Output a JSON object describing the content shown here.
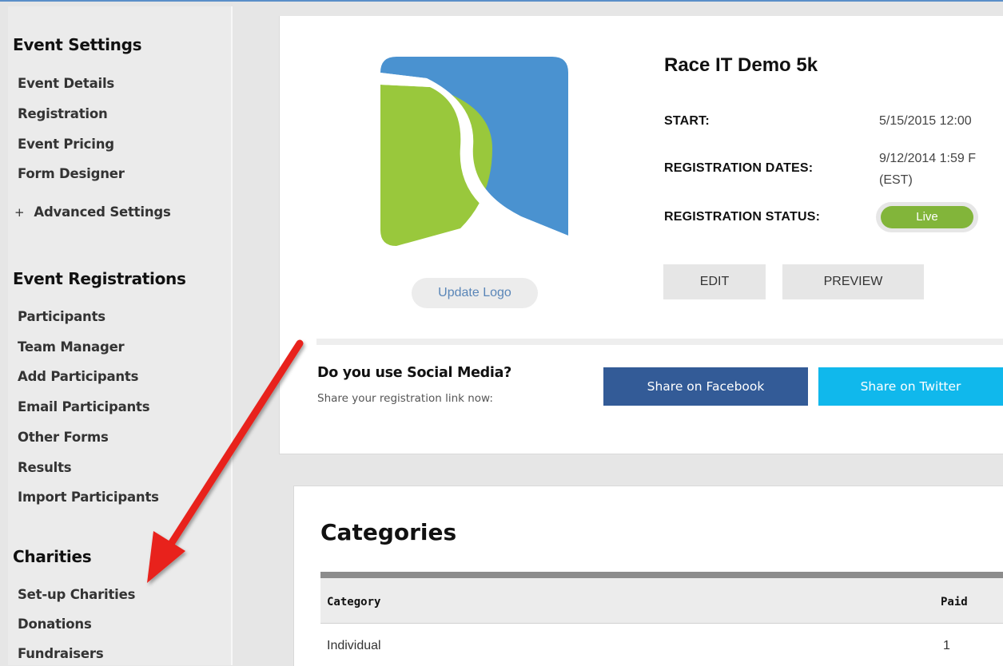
{
  "sidebar": {
    "sections": [
      {
        "title": "Event Settings",
        "items": [
          "Event Details",
          "Registration",
          "Event Pricing",
          "Form Designer"
        ],
        "advanced": "Advanced Settings"
      },
      {
        "title": "Event Registrations",
        "items": [
          "Participants",
          "Team Manager",
          "Add Participants",
          "Email Participants",
          "Other Forms",
          "Results",
          "Import Participants"
        ]
      },
      {
        "title": "Charities",
        "items": [
          "Set-up Charities",
          "Donations",
          "Fundraisers"
        ]
      }
    ]
  },
  "event": {
    "title": "Race IT Demo 5k",
    "start_label": "START:",
    "start_value": "5/15/2015 12:00",
    "reg_dates_label": "REGISTRATION DATES:",
    "reg_dates_value_line1": "9/12/2014 1:59 F",
    "reg_dates_value_line2": "(EST)",
    "reg_status_label": "REGISTRATION STATUS:",
    "reg_status_value": "Live",
    "update_logo": "Update Logo",
    "edit_label": "EDIT",
    "preview_label": "PREVIEW"
  },
  "social": {
    "question": "Do you use Social Media?",
    "subtitle": "Share your registration link now:",
    "facebook_label": "Share on Facebook",
    "twitter_label": "Share on Twitter"
  },
  "categories": {
    "title": "Categories",
    "columns": [
      "Category",
      "Paid"
    ],
    "rows": [
      [
        "Individual",
        "1"
      ]
    ]
  },
  "colors": {
    "accent_blue": "#4a92d0",
    "logo_green": "#99c83c",
    "live_green": "#82b53a",
    "facebook": "#335b97",
    "twitter": "#10b8ec",
    "arrow_red": "#e8201a"
  },
  "icons": {
    "logo": "race-it-logo",
    "annotation": "red-arrow-icon"
  }
}
